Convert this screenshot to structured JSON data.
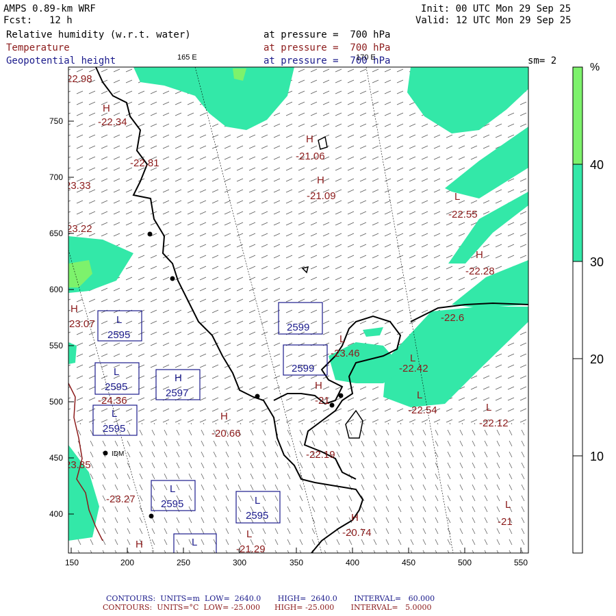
{
  "header": {
    "model": "AMPS 0.89-km WRF",
    "fcst_label": "Fcst:",
    "fcst_value": "12 h",
    "init": "Init: 00 UTC Mon 29 Sep 25",
    "valid": "Valid: 12 UTC Mon 29 Sep 25",
    "fields": [
      {
        "name": "Relative humidity (w.r.t. water)",
        "level": "at pressure =  700 hPa",
        "color": "#000000"
      },
      {
        "name": "Temperature",
        "level": "at pressure =  700 hPa",
        "color": "#8b1a1a"
      },
      {
        "name": "Geopotential height",
        "level": "at pressure =  700 hPa",
        "color": "#1a1a8b"
      }
    ],
    "smoothing": "sm= 2",
    "lon_labels": [
      "165 E",
      "170 E"
    ]
  },
  "axes": {
    "x_ticks": [
      "150",
      "200",
      "250",
      "300",
      "350",
      "400",
      "450",
      "500",
      "550"
    ],
    "y_ticks": [
      "750",
      "700",
      "650",
      "600",
      "550",
      "500",
      "450",
      "400"
    ]
  },
  "colorbar": {
    "unit": "%",
    "labels": [
      "40",
      "30",
      "20",
      "10"
    ],
    "colors": [
      "#7df26c",
      "#33e8a8",
      "#ffffff",
      "#ffffff",
      "#ffffff"
    ]
  },
  "map": {
    "rh_color": "#33e8a8",
    "rh_high_color": "#7df26c",
    "station": "IDM",
    "temp_labels": [
      {
        "sym": "H",
        "val": "-22.34"
      },
      {
        "sym": "",
        "val": "-22.81"
      },
      {
        "sym": "",
        "val": "-22.98"
      },
      {
        "sym": "",
        "val": "-23.33"
      },
      {
        "sym": "",
        "val": "-23.22"
      },
      {
        "sym": "H",
        "val": "-21.06"
      },
      {
        "sym": "H",
        "val": "-21.09"
      },
      {
        "sym": "L",
        "val": "-22.55"
      },
      {
        "sym": "H",
        "val": "-22.28"
      },
      {
        "sym": "",
        "val": "-22.6"
      },
      {
        "sym": "H",
        "val": "-23.07"
      },
      {
        "sym": "L",
        "val": "-23.46"
      },
      {
        "sym": "L",
        "val": "-22.42"
      },
      {
        "sym": "L",
        "val": "-22.54"
      },
      {
        "sym": "L",
        "val": "-22.12"
      },
      {
        "sym": "",
        "val": "-24.36"
      },
      {
        "sym": "H",
        "val": "-20.66"
      },
      {
        "sym": "H",
        "val": "-21"
      },
      {
        "sym": "",
        "val": "-22.19"
      },
      {
        "sym": "",
        "val": "-23.85"
      },
      {
        "sym": "",
        "val": "-23.27"
      },
      {
        "sym": "H",
        "val": "-20.74"
      },
      {
        "sym": "L",
        "val": "-21"
      },
      {
        "sym": "L",
        "val": "-21.29"
      },
      {
        "sym": "H",
        "val": ""
      }
    ],
    "height_boxes": [
      {
        "sym": "L",
        "val": "2595"
      },
      {
        "sym": "",
        "val": "2599"
      },
      {
        "sym": "",
        "val": "2599"
      },
      {
        "sym": "L",
        "val": "2595"
      },
      {
        "sym": "H",
        "val": "2597"
      },
      {
        "sym": "L",
        "val": "2595"
      },
      {
        "sym": "L",
        "val": "2595"
      },
      {
        "sym": "L",
        "val": "2595"
      },
      {
        "sym": "L",
        "val": ""
      }
    ]
  },
  "footer": {
    "line1": "CONTOURS:  UNITS=m  LOW=  2640.0       HIGH=  2640.0       INTERVAL=   60.000",
    "line2": "CONTOURS:  UNITS=°C  LOW= -25.000      HIGH= -25.000       INTERVAL=   5.0000",
    "line1_color": "#1a1a8b",
    "line2_color": "#8b1a1a"
  }
}
